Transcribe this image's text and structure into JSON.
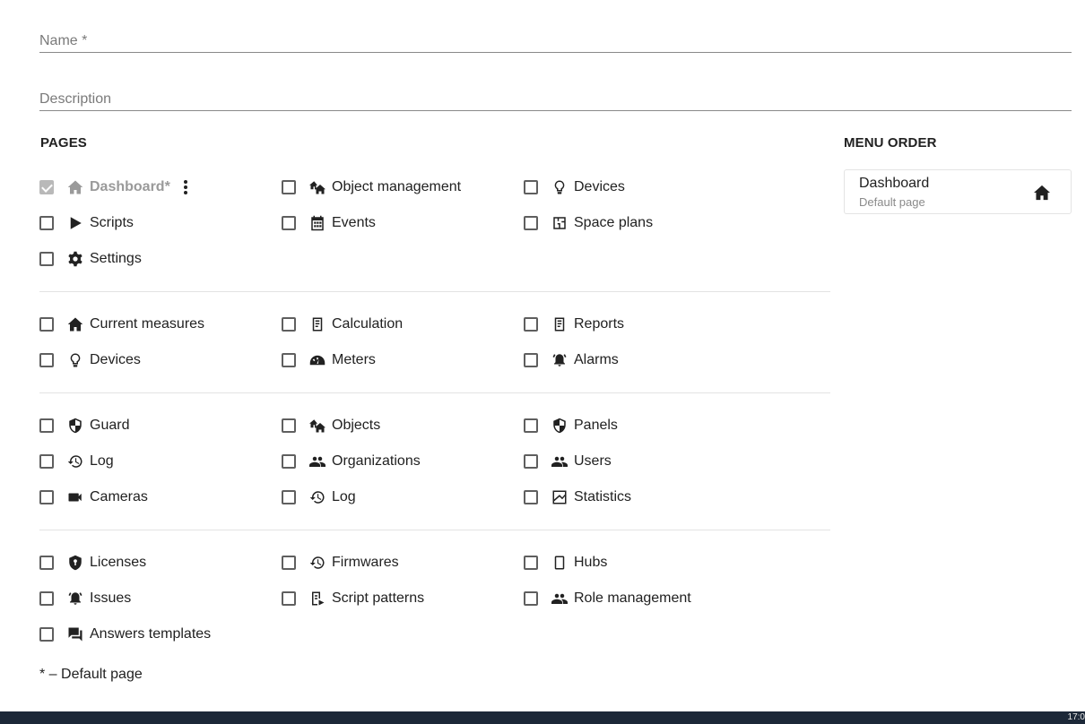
{
  "form": {
    "name_placeholder": "Name *",
    "description_placeholder": "Description"
  },
  "pages_title": "PAGES",
  "menu_order_title": "MENU ORDER",
  "groups": [
    [
      {
        "label": "Dashboard*",
        "icon": "home-icon",
        "checked": true,
        "disabled": true
      },
      {
        "label": "Object management",
        "icon": "houses-icon",
        "checked": false
      },
      {
        "label": "Devices",
        "icon": "lightbulb-icon",
        "checked": false
      },
      {
        "label": "Scripts",
        "icon": "play-icon",
        "checked": false
      },
      {
        "label": "Events",
        "icon": "calendar-icon",
        "checked": false
      },
      {
        "label": "Space plans",
        "icon": "space-plan-icon",
        "checked": false
      },
      {
        "label": "Settings",
        "icon": "gear-icon",
        "checked": false
      }
    ],
    [
      {
        "label": "Current measures",
        "icon": "home-icon",
        "checked": false
      },
      {
        "label": "Calculation",
        "icon": "document-icon",
        "checked": false
      },
      {
        "label": "Reports",
        "icon": "document-icon",
        "checked": false
      },
      {
        "label": "Devices",
        "icon": "lightbulb-icon",
        "checked": false
      },
      {
        "label": "Meters",
        "icon": "gauge-icon",
        "checked": false
      },
      {
        "label": "Alarms",
        "icon": "alarm-icon",
        "checked": false
      }
    ],
    [
      {
        "label": "Guard",
        "icon": "shield-icon",
        "checked": false
      },
      {
        "label": "Objects",
        "icon": "houses-icon",
        "checked": false
      },
      {
        "label": "Panels",
        "icon": "shield-icon",
        "checked": false
      },
      {
        "label": "Log",
        "icon": "history-icon",
        "checked": false
      },
      {
        "label": "Organizations",
        "icon": "people-icon",
        "checked": false
      },
      {
        "label": "Users",
        "icon": "people-icon",
        "checked": false
      },
      {
        "label": "Cameras",
        "icon": "camera-icon",
        "checked": false
      },
      {
        "label": "Log",
        "icon": "history-icon",
        "checked": false
      },
      {
        "label": "Statistics",
        "icon": "chart-icon",
        "checked": false
      }
    ],
    [
      {
        "label": "Licenses",
        "icon": "license-icon",
        "checked": false
      },
      {
        "label": "Firmwares",
        "icon": "history-icon",
        "checked": false
      },
      {
        "label": "Hubs",
        "icon": "hub-icon",
        "checked": false
      },
      {
        "label": "Issues",
        "icon": "alarm-icon",
        "checked": false
      },
      {
        "label": "Script patterns",
        "icon": "script-pattern-icon",
        "checked": false
      },
      {
        "label": "Role management",
        "icon": "people-icon",
        "checked": false
      },
      {
        "label": "Answers templates",
        "icon": "chat-icon",
        "checked": false
      }
    ]
  ],
  "footnote": "* – Default page",
  "menu_order": [
    {
      "title": "Dashboard",
      "subtitle": "Default page",
      "icon": "home-icon"
    }
  ],
  "taskbar": {
    "clock": "17:0"
  },
  "colors": {
    "taskbar": "#1c2838",
    "disabled_text": "#9a9a9a",
    "text": "#212121"
  }
}
